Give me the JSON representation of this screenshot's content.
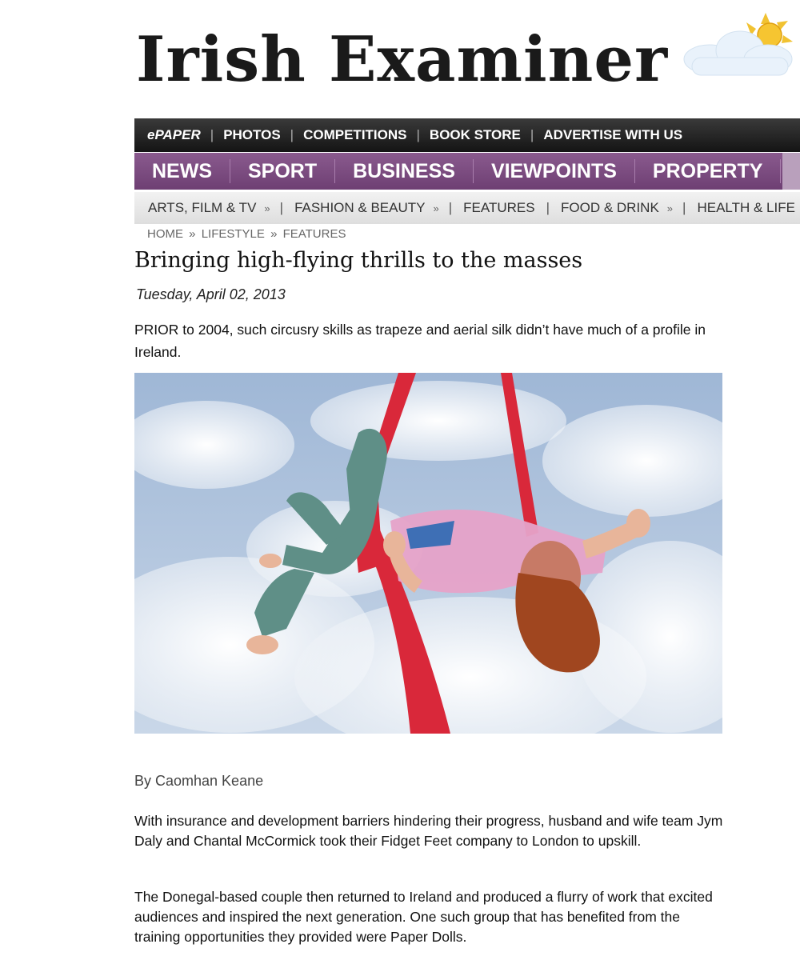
{
  "masthead": {
    "title": "Irish Examiner"
  },
  "utility_nav": {
    "items": [
      "ePAPER",
      "PHOTOS",
      "COMPETITIONS",
      "BOOK STORE",
      "ADVERTISE WITH US"
    ]
  },
  "section_nav": {
    "items": [
      "NEWS",
      "SPORT",
      "BUSINESS",
      "VIEWPOINTS",
      "PROPERTY"
    ],
    "color": "#7a4a7f"
  },
  "sub_nav": {
    "items": [
      {
        "label": "ARTS, FILM & TV",
        "dropdown": true
      },
      {
        "label": "FASHION & BEAUTY",
        "dropdown": true
      },
      {
        "label": "FEATURES",
        "dropdown": false
      },
      {
        "label": "FOOD & DRINK",
        "dropdown": true
      },
      {
        "label": "HEALTH & LIFE",
        "dropdown": true
      }
    ],
    "dropdown_glyph": "»",
    "separator": "|"
  },
  "breadcrumb": {
    "items": [
      "HOME",
      "LIFESTYLE",
      "FEATURES"
    ],
    "separator": "»"
  },
  "article": {
    "headline": "Bringing high-flying thrills to the masses",
    "date": "Tuesday, April 02, 2013",
    "intro": "PRIOR to 2004, such circusry skills as trapeze and aerial silk didn’t have much of a profile in Ireland.",
    "byline": "By Caomhan Keane",
    "paragraphs": [
      "With insurance and development barriers hindering their progress, husband and wife team Jym Daly and Chantal McCormick took their Fidget Feet company to London to upskill.",
      "The Donegal-based couple then returned to Ireland and produced a flurry of work that excited audiences and inspired the next generation. One such group that has benefited from the training opportunities they provided were Paper Dolls."
    ],
    "photo_icon": "aerial-silk-performer-photo"
  },
  "weather_icon": "sun-cloud-icon"
}
